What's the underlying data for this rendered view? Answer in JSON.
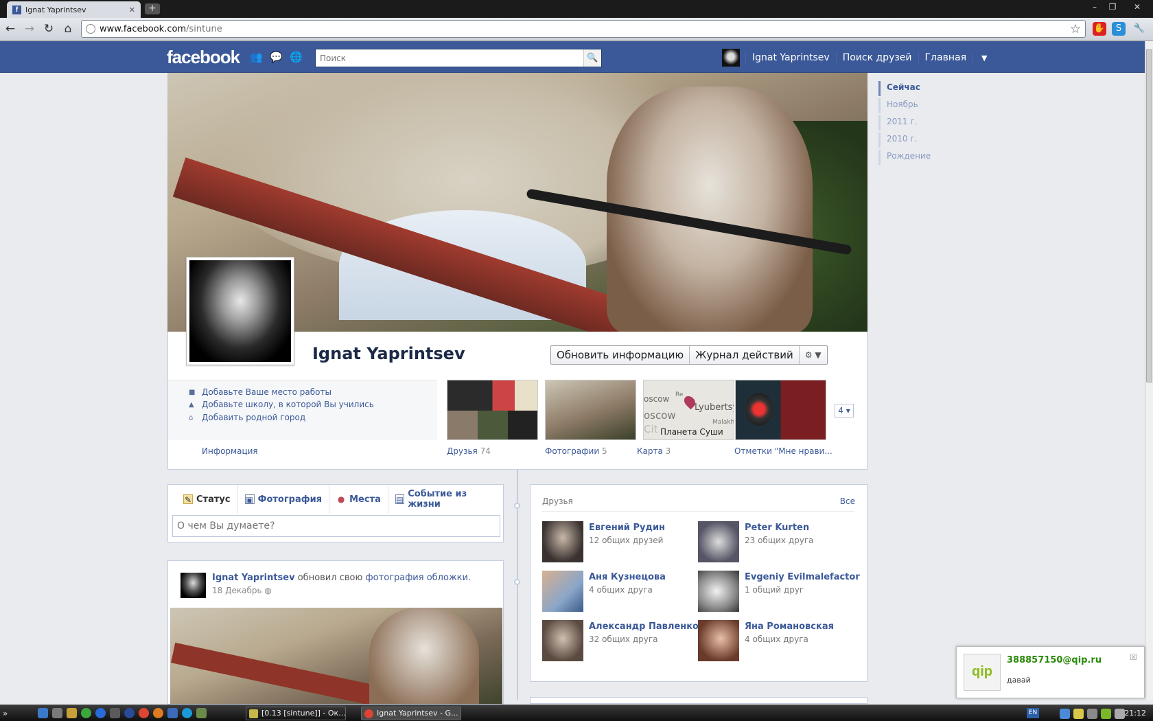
{
  "browser": {
    "tab_title": "Ignat Yaprintsev",
    "tab_favicon": "f",
    "url_host": "www.facebook.com",
    "url_path": "/sintune"
  },
  "fb": {
    "logo": "facebook",
    "search_placeholder": "Поиск",
    "nav": {
      "user": "Ignat Yaprintsev",
      "find_friends": "Поиск друзей",
      "home": "Главная"
    }
  },
  "profile": {
    "name": "Ignat Yaprintsev",
    "update_info": "Обновить информацию",
    "activity_log": "Журнал действий",
    "info_items": [
      "Добавьте Ваше место работы",
      "Добавьте школу, в которой Вы учились",
      "Добавить родной город"
    ],
    "info_label": "Информация",
    "thumbs": [
      {
        "label": "Друзья",
        "count": "74"
      },
      {
        "label": "Фотографии",
        "count": "5"
      },
      {
        "label": "Карта",
        "count": "3"
      },
      {
        "label": "Отметки \"Мне нрави...",
        "count": ""
      }
    ],
    "map_labels": [
      "oscow",
      "Re",
      "oscow",
      "Lyubertsy",
      "Cit",
      "Malakh",
      "Планета Суши"
    ],
    "more_count": "4"
  },
  "timeline_nav": [
    "Сейчас",
    "Ноябрь",
    "2011 г.",
    "2010 г.",
    "Рождение"
  ],
  "composer": {
    "tabs": [
      "Статус",
      "Фотография",
      "Места",
      "Событие из жизни"
    ],
    "placeholder": "О чем Вы думаете?"
  },
  "post": {
    "author": "Ignat Yaprintsev",
    "action": "обновил свою",
    "object": "фотография обложки.",
    "date": "18 Декабрь"
  },
  "friends": {
    "title": "Друзья",
    "all": "Все",
    "list": [
      {
        "name": "Евгений Рудин",
        "mutual": "12 общих друзей"
      },
      {
        "name": "Peter Kurten",
        "mutual": "23 общих друга"
      },
      {
        "name": "Аня Кузнецова",
        "mutual": "4 общих друга"
      },
      {
        "name": "Evgeniy Evilmalefactor",
        "mutual": "1 общий друг"
      },
      {
        "name": "Александр Павленко",
        "mutual": "32 общих друга"
      },
      {
        "name": "Яна Романовская",
        "mutual": "4 общих друга"
      }
    ]
  },
  "qip": {
    "logo": "qip",
    "contact": "388857150@qip.ru",
    "message": "давай"
  },
  "taskbar": {
    "windows": [
      "[0.13 [sintune]] - Ок...",
      "Ignat Yaprintsev - G..."
    ],
    "lang": "EN",
    "clock": "21:12"
  },
  "colors": {
    "fb_blue": "#3b5998",
    "qip_green": "#2a8a0a"
  }
}
